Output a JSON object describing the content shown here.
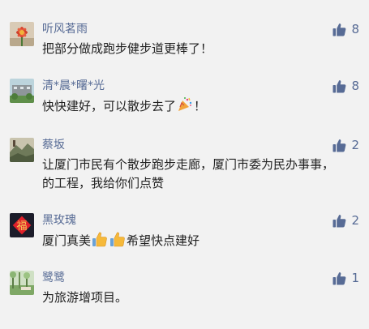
{
  "comments": [
    {
      "name": "听风茗雨",
      "text": "把部分做成跑步健步道更棒了！",
      "likes": "8",
      "avatar_icon": "flower-avatar"
    },
    {
      "name": "清*晨*曙*光",
      "text_before": "快快建好，可以散步去了",
      "text_after": "！",
      "emoji": "party-popper-icon",
      "likes": "8",
      "avatar_icon": "building-avatar"
    },
    {
      "name": "蔡坂",
      "text": "让厦门市民有个散步跑步走廊，厦门市委为民办事事，的工程，我给你们点赞",
      "likes": "2",
      "avatar_icon": "landscape-avatar"
    },
    {
      "name": "黑玫瑰",
      "text_before": "厦门真美",
      "text_after": "希望快点建好",
      "emoji": "thumbs-up-icon",
      "likes": "2",
      "avatar_icon": "fu-character-avatar",
      "avatar_text": "福"
    },
    {
      "name": "鹭鹭",
      "text": "为旅游增项目。",
      "likes": "1",
      "avatar_icon": "garden-avatar"
    }
  ],
  "colors": {
    "name": "#576b95",
    "text": "#222222",
    "like_icon": "#576b95",
    "background": "#f2f2f2"
  }
}
